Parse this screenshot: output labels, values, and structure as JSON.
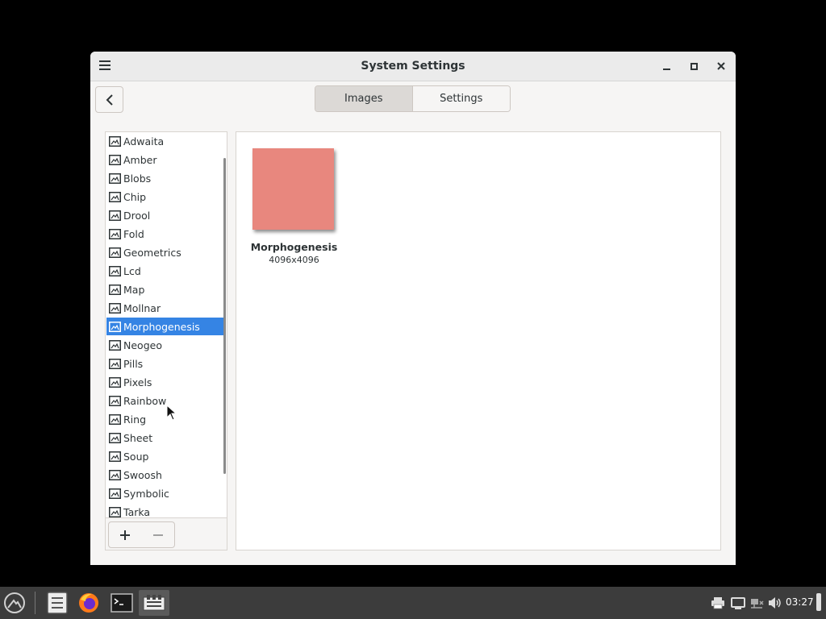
{
  "window": {
    "title": "System Settings",
    "icons": {
      "menu": "hamburger-menu-icon",
      "minimize": "minimize-icon",
      "maximize": "maximize-icon",
      "close": "close-icon"
    }
  },
  "toolbar": {
    "back_icon": "chevron-left-icon",
    "tabs": [
      {
        "label": "Images",
        "active": true
      },
      {
        "label": "Settings",
        "active": false
      }
    ]
  },
  "sidebar": {
    "items": [
      {
        "label": "Adwaita"
      },
      {
        "label": "Amber"
      },
      {
        "label": "Blobs"
      },
      {
        "label": "Chip"
      },
      {
        "label": "Drool"
      },
      {
        "label": "Fold"
      },
      {
        "label": "Geometrics"
      },
      {
        "label": "Lcd"
      },
      {
        "label": "Map"
      },
      {
        "label": "Mollnar"
      },
      {
        "label": "Morphogenesis"
      },
      {
        "label": "Neogeo"
      },
      {
        "label": "Pills"
      },
      {
        "label": "Pixels"
      },
      {
        "label": "Rainbow"
      },
      {
        "label": "Ring"
      },
      {
        "label": "Sheet"
      },
      {
        "label": "Soup"
      },
      {
        "label": "Swoosh"
      },
      {
        "label": "Symbolic"
      },
      {
        "label": "Tarka"
      }
    ],
    "selected": "Morphogenesis",
    "add_icon": "plus-icon",
    "remove_icon": "minus-icon"
  },
  "main": {
    "thumbnail": {
      "name": "Morphogenesis",
      "size": "4096x4096",
      "color": "#e8877e"
    }
  },
  "taskbar": {
    "apps": [
      "app-menu-icon",
      "file-manager-icon",
      "firefox-icon",
      "terminal-icon",
      "settings-app-icon"
    ],
    "tray": [
      "printer-icon",
      "display-icon",
      "network-icon",
      "volume-icon"
    ],
    "clock": "03:27"
  },
  "colors": {
    "accent": "#3584e4",
    "taskbar": "#3c3c3c",
    "desktop": "#000000"
  }
}
